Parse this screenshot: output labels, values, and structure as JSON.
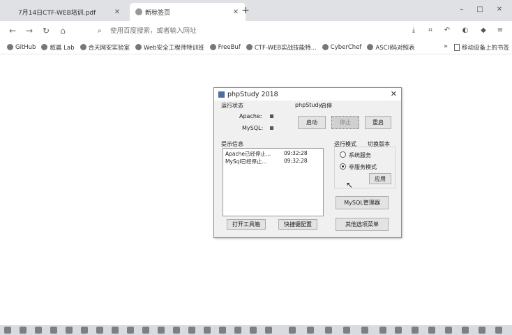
{
  "tabs": [
    {
      "title": "7月14日CTF-WEB培训.pdf",
      "active": false
    },
    {
      "title": "新标签页",
      "active": true
    }
  ],
  "window_controls": {
    "minimize": "–",
    "maximize": "□",
    "close": "✕"
  },
  "toolbar": {
    "omnibox_placeholder": "使用百度搜索，或者输入网址",
    "new_tab": "+"
  },
  "bookmarks": [
    {
      "label": "GitHub"
    },
    {
      "label": "叙晨 Lab"
    },
    {
      "label": "合天网安实验室"
    },
    {
      "label": "Web安全工程师特训班"
    },
    {
      "label": "FreeBuf"
    },
    {
      "label": "CTF-WEB实战技能特..."
    },
    {
      "label": "CyberChef"
    },
    {
      "label": "ASCII码对照表"
    }
  ],
  "bookmarks_more": "»",
  "mobile_bookmarks": "移动设备上的书签",
  "dialog": {
    "title": "phpStudy 2018",
    "run_status_label": "运行状态",
    "apache_label": "Apache:",
    "mysql_label": "MySQL:",
    "phpstudy_label": "phpStudy",
    "phpstudy_state": "启停",
    "buttons": {
      "start": "启动",
      "stop": "停止",
      "restart": "重启",
      "open_toolbox": "打开工具箱",
      "quick_config": "快捷键配置",
      "mysql_manager": "MySQL管理器",
      "other_options": "其他选项菜单",
      "apply": "应用"
    },
    "info_label": "提示信息",
    "log": [
      {
        "message": "Apache已经停止...",
        "time": "09:32:28"
      },
      {
        "message": "MySql已经停止...",
        "time": "09:32:28"
      }
    ],
    "run_mode_label": "运行模式",
    "switch_version_label": "切换版本",
    "mode_options": [
      {
        "label": "系统服务",
        "selected": false
      },
      {
        "label": "非服务模式",
        "selected": true
      }
    ],
    "close": "✕"
  },
  "colors": {
    "tabstrip": "#dfe1e5",
    "dialog_bg": "#f0f0f0",
    "taskbar": "#d9dbe0"
  }
}
